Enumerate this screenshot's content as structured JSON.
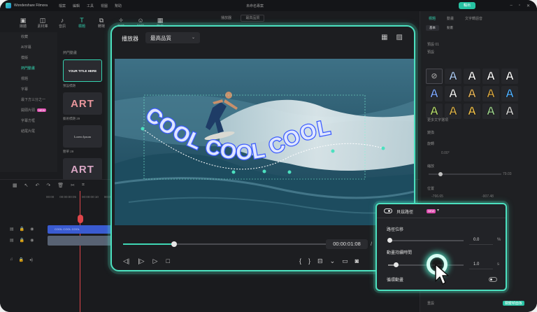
{
  "titlebar": {
    "app_name": "Wondershare Filmora",
    "menu": [
      "檔案",
      "編輯",
      "工具",
      "視圖",
      "幫助"
    ],
    "project": "未命名專案",
    "export_label": "輸出"
  },
  "toolbar": {
    "items": [
      {
        "icon": "media-icon",
        "label": "媒體"
      },
      {
        "icon": "stock-icon",
        "label": "素材庫"
      },
      {
        "icon": "audio-icon",
        "label": "音訊"
      },
      {
        "icon": "title-icon",
        "label": "標題"
      },
      {
        "icon": "transition-icon",
        "label": "轉場"
      },
      {
        "icon": "effects-icon",
        "label": "特效"
      },
      {
        "icon": "stickers-icon",
        "label": "貼圖"
      },
      {
        "icon": "templates-icon",
        "label": "範本"
      }
    ]
  },
  "sidebar": {
    "items": [
      "收藏",
      "AI字幕",
      "模版",
      "熱門動畫",
      "標題",
      "字幕",
      "最下方三分之一",
      "開頭片頭",
      "字幕方框",
      "結尾片尾"
    ],
    "new_badge": "NEW"
  },
  "assets": {
    "section": "熱門動畫",
    "tiles": [
      {
        "text": "YOUR TITLE HERE",
        "caption": "預設標題"
      },
      {
        "text": "ART",
        "caption": "藝術標題 29",
        "color": "#e8959b"
      },
      {
        "text": "Lorem Ipsum",
        "caption": "簡單 29"
      },
      {
        "text": "ART",
        "caption": "",
        "color": "#d9a6c4"
      }
    ]
  },
  "timeline": {
    "ruler": [
      "00:00",
      "00:00:00:05",
      "00:00:00:10",
      "00:00:00:15",
      "00:00:00:20"
    ],
    "clip_label": "COOL COOL COOL"
  },
  "preview_top": {
    "label": "播放器",
    "quality": "最高品質"
  },
  "player": {
    "title": "播放器",
    "quality": "最高品質",
    "overlay_text": "COOL COOL COOL",
    "progress": 0.25,
    "timecode": "00:00:01:08",
    "separator": "/",
    "total_partial": "0"
  },
  "properties": {
    "tabs": [
      "標題",
      "動畫",
      "文字轉語音"
    ],
    "subtabs": [
      "基本",
      "動畫"
    ],
    "preset_label": "預設 01",
    "section_preset": "預設",
    "section_style": "更多文字選項",
    "transform": "變換",
    "rotate_label": "旋轉",
    "rotate_value": "0.00°",
    "scale_label": "縮放",
    "scale_value": "79.03",
    "position_label": "位置",
    "pos_x": "-766.65",
    "pos_y": "-907.48",
    "reset_label": "重設",
    "keyframe_label": "關鍵幀面板",
    "preset_colors": [
      "#8b8b8b",
      "#a9c7ef",
      "#ffffff",
      "#ffffff",
      "#ffffff",
      "#7ea8ff",
      "#f3f3f3",
      "#e7b55a",
      "#d6a642",
      "#4fb0ff",
      "#b3d96b",
      "#d9b04a",
      "#f1c14b",
      "#9dd38d",
      "#d2d2d2"
    ]
  },
  "popup": {
    "title": "貝茲路徑",
    "new_badge": "NEW",
    "path_offset_label": "路徑位移",
    "path_offset_value": "0.0",
    "path_offset_unit": "%",
    "anim_duration_label": "動畫持續時間",
    "anim_duration_value": "1.0",
    "anim_duration_unit": "s",
    "loop_label": "循環動畫",
    "path_offset": 0.0,
    "anim_duration_fraction": 0.1
  },
  "colors": {
    "accent": "#3fd6b4",
    "highlight": "#4ce0bf",
    "text_blue": "#3a5bff"
  }
}
